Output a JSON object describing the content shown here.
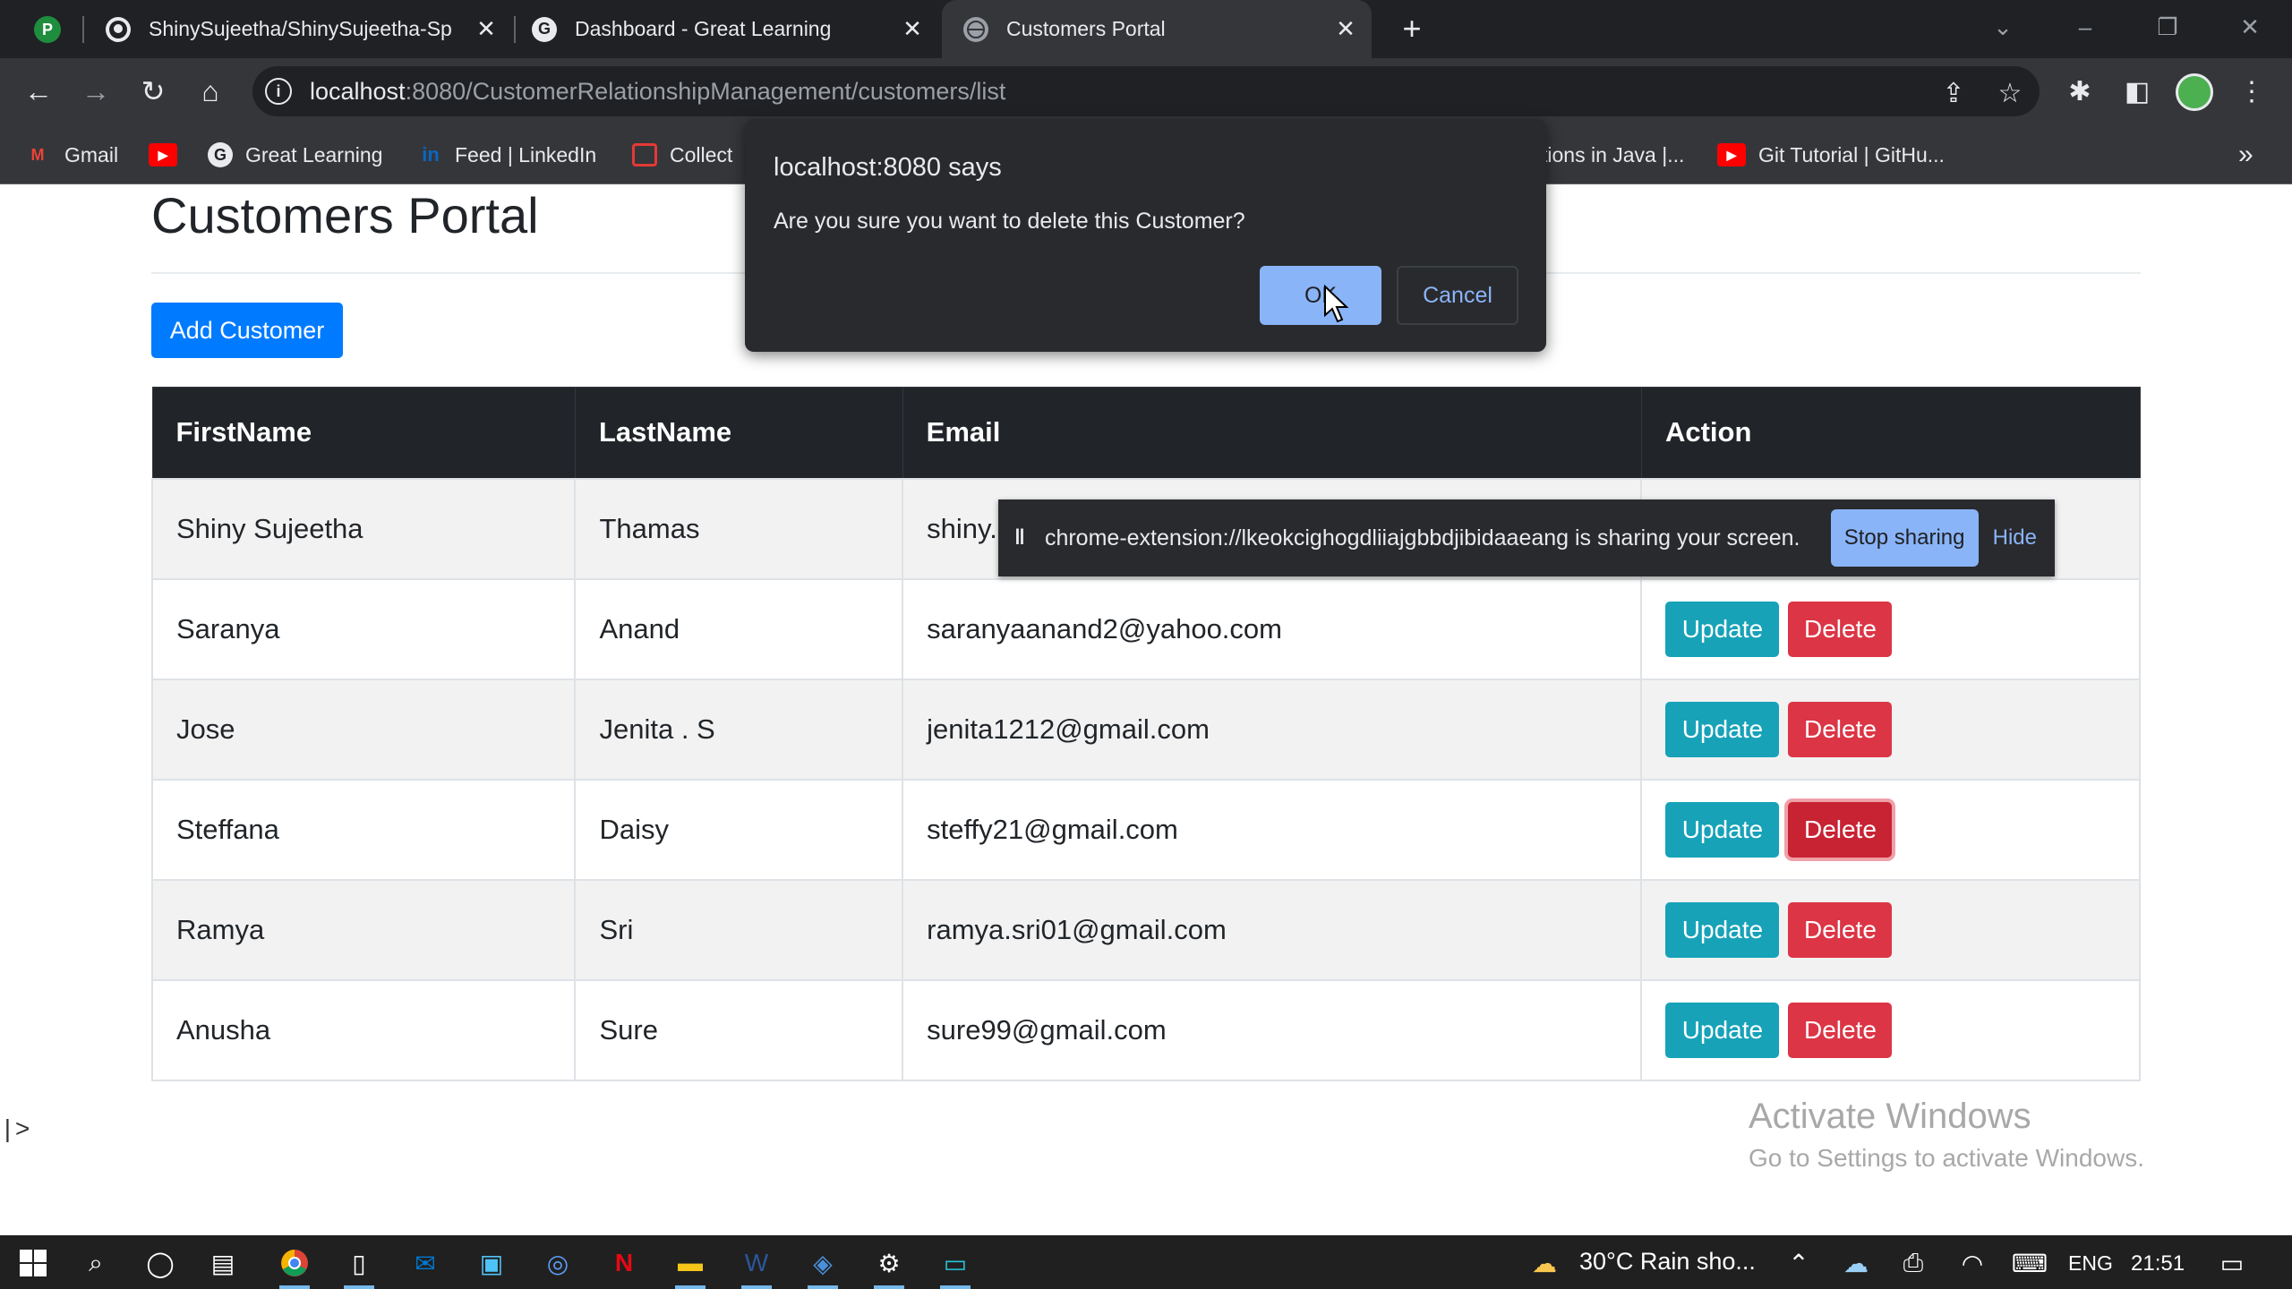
{
  "browser": {
    "tabs": [
      {
        "title": "ShinySujeetha/ShinySujeetha-Sp",
        "close": "✕"
      },
      {
        "title": "Dashboard - Great Learning",
        "close": "✕"
      },
      {
        "title": "Customers Portal",
        "close": "✕"
      }
    ],
    "new_tab": "+",
    "url_host": "localhost",
    "url_path": ":8080/CustomerRelationshipManagement/customers/list",
    "bookmarks": [
      {
        "label": "Gmail"
      },
      {
        "label": ""
      },
      {
        "label": "Great Learning"
      },
      {
        "label": "Feed | LinkedIn"
      },
      {
        "label": "Collect"
      },
      {
        "label": "tions in Java |..."
      },
      {
        "label": "Git Tutorial | GitHu..."
      }
    ],
    "overflow": "»"
  },
  "page": {
    "title": "Customers Portal",
    "add_button": "Add Customer",
    "columns": [
      "FirstName",
      "LastName",
      "Email",
      "Action"
    ],
    "rows": [
      {
        "first": "Shiny Sujeetha",
        "last": "Thamas",
        "email": "shiny."
      },
      {
        "first": "Saranya",
        "last": "Anand",
        "email": "saranyaanand2@yahoo.com"
      },
      {
        "first": "Jose",
        "last": "Jenita . S",
        "email": "jenita1212@gmail.com"
      },
      {
        "first": "Steffana",
        "last": "Daisy",
        "email": "steffy21@gmail.com"
      },
      {
        "first": "Ramya",
        "last": "Sri",
        "email": "ramya.sri01@gmail.com"
      },
      {
        "first": "Anusha",
        "last": "Sure",
        "email": "sure99@gmail.com"
      }
    ],
    "update_label": "Update",
    "delete_label": "Delete",
    "stray_text": "|>"
  },
  "sharing_bar": {
    "message": "chrome-extension://lkeokcighogdliiajgbbdjibidaaeang is sharing your screen.",
    "stop_label": "Stop sharing",
    "hide_label": "Hide"
  },
  "dialog": {
    "origin": "localhost:8080 says",
    "message": "Are you sure you want to delete this Customer?",
    "ok_label": "OK",
    "cancel_label": "Cancel"
  },
  "watermark": {
    "line1": "Activate Windows",
    "line2": "Go to Settings to activate Windows."
  },
  "taskbar": {
    "weather": "30°C  Rain sho...",
    "language": "ENG",
    "time": "21:51"
  }
}
